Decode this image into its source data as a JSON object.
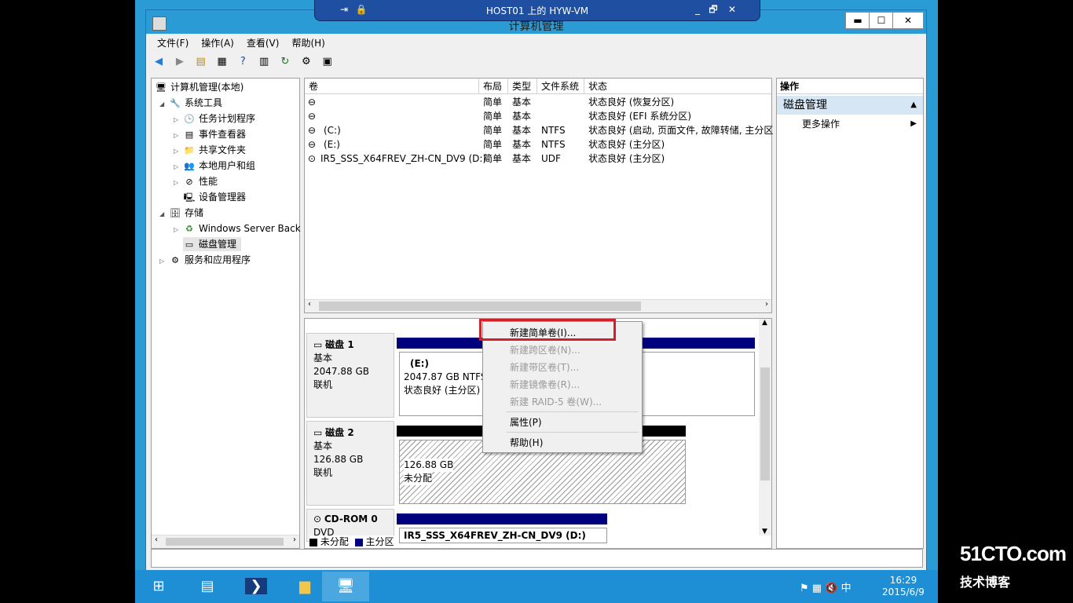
{
  "rdp": {
    "title": "HOST01 上的 HYW-VM",
    "pin_icon": "pin-icon",
    "lock_icon": "lock-icon",
    "minimize": "_",
    "restore": "🗗",
    "close": "✕"
  },
  "window": {
    "title": "计算机管理",
    "min": "▬",
    "max": "☐",
    "close": "✕"
  },
  "menu": [
    "文件(F)",
    "操作(A)",
    "查看(V)",
    "帮助(H)"
  ],
  "tree": {
    "root": "计算机管理(本地)",
    "system_tools": "系统工具",
    "task_scheduler": "任务计划程序",
    "event_viewer": "事件查看器",
    "shared_folders": "共享文件夹",
    "local_users": "本地用户和组",
    "performance": "性能",
    "device_manager": "设备管理器",
    "storage": "存储",
    "wsb": "Windows Server Back",
    "disk_mgmt": "磁盘管理",
    "services": "服务和应用程序"
  },
  "volume_table": {
    "headers": [
      "卷",
      "布局",
      "类型",
      "文件系统",
      "状态"
    ],
    "rows": [
      {
        "name": "",
        "layout": "简单",
        "type": "基本",
        "fs": "",
        "status": "状态良好 (恢复分区)"
      },
      {
        "name": "",
        "layout": "简单",
        "type": "基本",
        "fs": "",
        "status": "状态良好 (EFI 系统分区)"
      },
      {
        "name": "(C:)",
        "layout": "简单",
        "type": "基本",
        "fs": "NTFS",
        "status": "状态良好 (启动, 页面文件, 故障转储, 主分区"
      },
      {
        "name": "(E:)",
        "layout": "简单",
        "type": "基本",
        "fs": "NTFS",
        "status": "状态良好 (主分区)"
      },
      {
        "name": "IR5_SSS_X64FREV_ZH-CN_DV9 (D:)",
        "layout": "简单",
        "type": "基本",
        "fs": "UDF",
        "status": "状态良好 (主分区)"
      }
    ]
  },
  "disks": [
    {
      "name": "磁盘 1",
      "type": "基本",
      "size": "2047.88 GB",
      "state": "联机",
      "part_label": "(E:)",
      "part_size": "2047.87 GB NTFS",
      "part_status": "状态良好 (主分区)"
    },
    {
      "name": "磁盘 2",
      "type": "基本",
      "size": "126.88 GB",
      "state": "联机",
      "part_size": "126.88 GB",
      "part_status": "未分配"
    },
    {
      "name": "CD-ROM 0",
      "type": "DVD",
      "part_label": "IR5_SSS_X64FREV_ZH-CN_DV9  (D:)"
    }
  ],
  "legend": {
    "unallocated": "未分配",
    "primary": "主分区",
    "unallocated_color": "#000000",
    "primary_color": "#00007f"
  },
  "actions": {
    "header": "操作",
    "section": "磁盘管理",
    "more": "更多操作"
  },
  "context_menu": {
    "new_simple": "新建简单卷(I)...",
    "new_spanned": "新建跨区卷(N)...",
    "new_striped": "新建带区卷(T)...",
    "new_mirrored": "新建镜像卷(R)...",
    "new_raid5": "新建 RAID-5 卷(W)...",
    "properties": "属性(P)",
    "help": "帮助(H)"
  },
  "taskbar": {
    "time": "16:29",
    "date": "2015/6/9",
    "ime": "中"
  },
  "watermark": {
    "line1": "51CTO.com",
    "line2": "技术博客"
  }
}
